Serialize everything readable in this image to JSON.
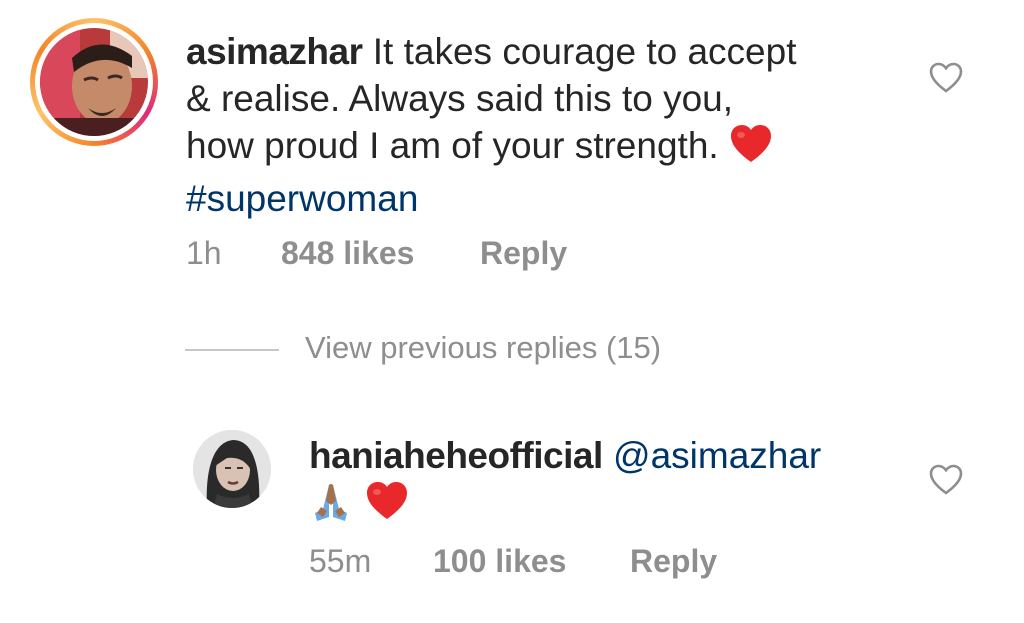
{
  "comment": {
    "username": "asimazhar",
    "text_line1": "It takes courage to accept",
    "text_line2": "& realise. Always said this to you,",
    "text_line3": "how proud I am of your strength.",
    "hashtag": "#superwoman",
    "time": "1h",
    "likes": "848 likes",
    "reply_label": "Reply",
    "avatar": "user-photo-avatar",
    "like_icon": "heart-outline-icon",
    "heart_emoji": "red-heart-emoji"
  },
  "view_previous_replies": "View previous replies (15)",
  "reply": {
    "username": "haniaheheofficial",
    "mention": "@asimazhar",
    "emojis": [
      "folded-hands-emoji",
      "red-heart-emoji"
    ],
    "time": "55m",
    "likes": "100 likes",
    "reply_label": "Reply",
    "avatar": "user-photo-avatar",
    "like_icon": "heart-outline-icon"
  },
  "colors": {
    "text": "#262626",
    "meta": "#8e8e8e",
    "link": "#003569",
    "heart_red": "#e8282b",
    "ring_orange": "#f58529",
    "ring_pink": "#dd2a7b",
    "divider": "#c7c7c7"
  }
}
